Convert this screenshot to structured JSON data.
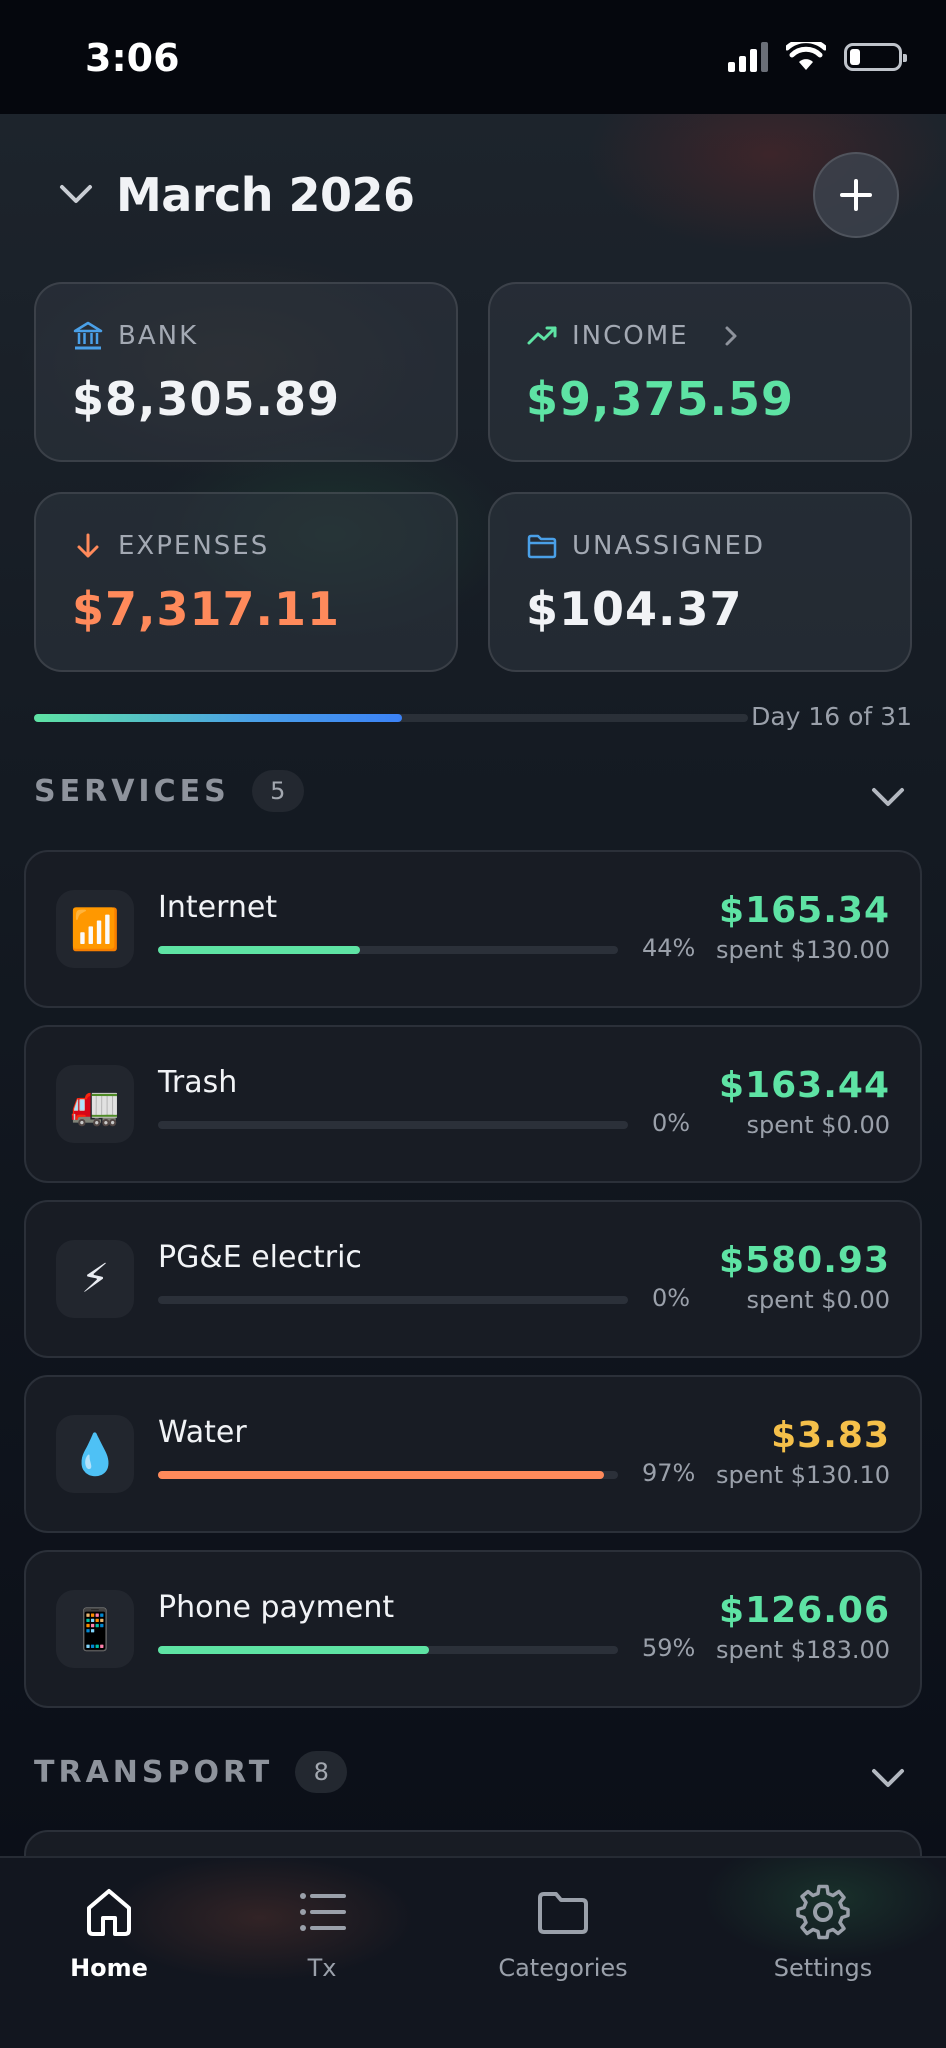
{
  "status": {
    "time": "3:06"
  },
  "header": {
    "month": "March 2026"
  },
  "cards": {
    "bank": {
      "label": "BANK",
      "value": "$8,305.89",
      "color": "#f1f3f6"
    },
    "income": {
      "label": "INCOME",
      "value": "$9,375.59",
      "color": "#5ee3a4"
    },
    "expenses": {
      "label": "EXPENSES",
      "value": "$7,317.11",
      "color": "#ff8a5b"
    },
    "unassigned": {
      "label": "UNASSIGNED",
      "value": "$104.37",
      "color": "#f1f3f6"
    }
  },
  "month_progress": {
    "fraction": 0.516,
    "label": "Day 16 of 31"
  },
  "sections": {
    "services": {
      "title": "SERVICES",
      "count": "5",
      "items": [
        {
          "icon": "signal-bars-icon",
          "emoji": "📶",
          "name": "Internet",
          "percent": "44%",
          "fraction": 0.44,
          "amount": "$165.34",
          "spent": "spent $130.00",
          "bar_color": "#5ee3a4",
          "amount_color": "#5ee3a4"
        },
        {
          "icon": "truck-icon",
          "emoji": "🚛",
          "name": "Trash",
          "percent": "0%",
          "fraction": 0,
          "amount": "$163.44",
          "spent": "spent $0.00",
          "bar_color": "#5ee3a4",
          "amount_color": "#5ee3a4"
        },
        {
          "icon": "lightning-icon",
          "emoji": "⚡",
          "name": "PG&E electric",
          "percent": "0%",
          "fraction": 0,
          "amount": "$580.93",
          "spent": "spent $0.00",
          "bar_color": "#5ee3a4",
          "amount_color": "#5ee3a4"
        },
        {
          "icon": "water-drop-icon",
          "emoji": "💧",
          "name": "Water",
          "percent": "97%",
          "fraction": 0.97,
          "amount": "$3.83",
          "spent": "spent $130.10",
          "bar_color": "#ff8a5b",
          "amount_color": "#f5c04a"
        },
        {
          "icon": "mobile-phone-icon",
          "emoji": "📱",
          "name": "Phone payment",
          "percent": "59%",
          "fraction": 0.59,
          "amount": "$126.06",
          "spent": "spent $183.00",
          "bar_color": "#5ee3a4",
          "amount_color": "#5ee3a4"
        }
      ]
    },
    "transport": {
      "title": "TRANSPORT",
      "count": "8"
    }
  },
  "nav": {
    "home": "Home",
    "tx": "Tx",
    "categories": "Categories",
    "settings": "Settings"
  }
}
